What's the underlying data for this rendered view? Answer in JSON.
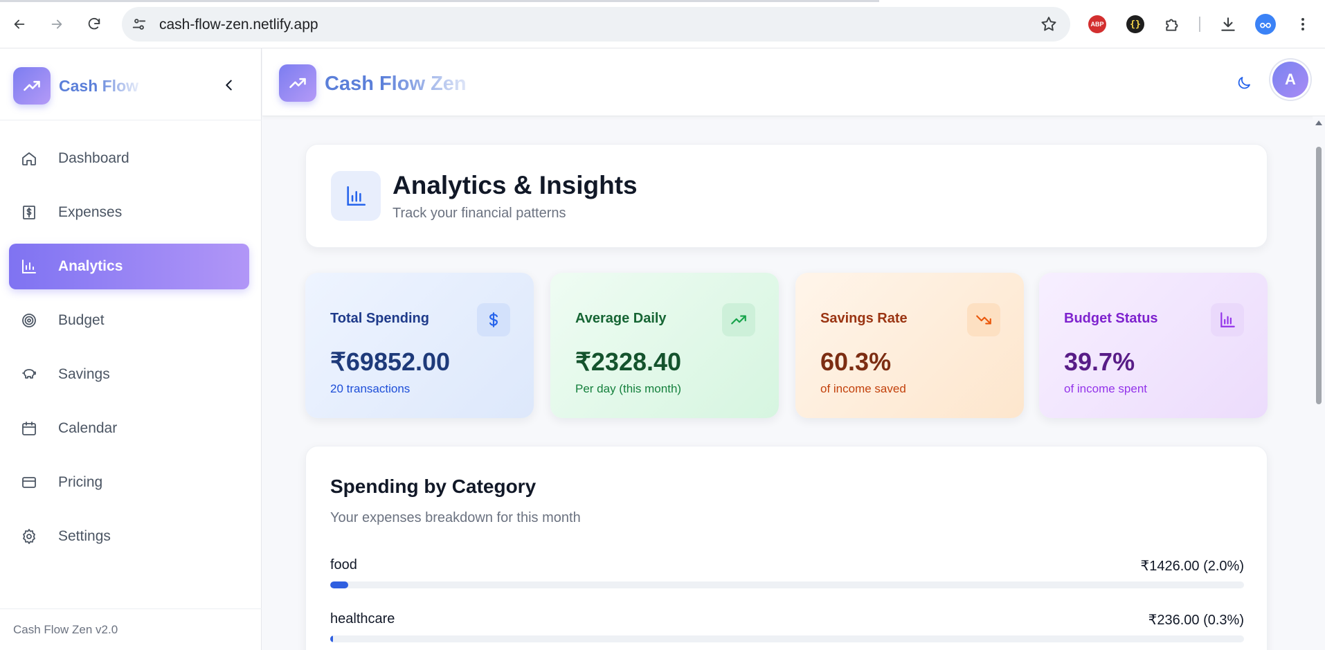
{
  "browser": {
    "url": "cash-flow-zen.netlify.app",
    "extensions": [
      "abp-extension-icon",
      "braces-extension-icon",
      "puzzle-extension-icon",
      "download-icon",
      "profile-icon",
      "menu-dots-icon"
    ],
    "abp_label": "ABP",
    "brace_label": "{}"
  },
  "sidebar": {
    "brand": "Cash Flow",
    "items": [
      {
        "label": "Dashboard",
        "icon": "home-icon"
      },
      {
        "label": "Expenses",
        "icon": "receipt-icon"
      },
      {
        "label": "Analytics",
        "icon": "bar-chart-icon",
        "active": true
      },
      {
        "label": "Budget",
        "icon": "target-icon"
      },
      {
        "label": "Savings",
        "icon": "piggy-bank-icon"
      },
      {
        "label": "Calendar",
        "icon": "calendar-icon"
      },
      {
        "label": "Pricing",
        "icon": "credit-card-icon"
      },
      {
        "label": "Settings",
        "icon": "gear-icon"
      }
    ],
    "footer": "Cash Flow Zen v2.0"
  },
  "header": {
    "brand": "Cash Flow Zen",
    "avatar_initial": "A"
  },
  "page": {
    "title": "Analytics & Insights",
    "subtitle": "Track your financial patterns"
  },
  "stats": [
    {
      "label": "Total Spending",
      "value": "₹69852.00",
      "sub": "20 transactions",
      "icon": "dollar-icon",
      "color": "#2563eb"
    },
    {
      "label": "Average Daily",
      "value": "₹2328.40",
      "sub": "Per day (this month)",
      "icon": "trending-up-icon",
      "color": "#16a34a"
    },
    {
      "label": "Savings Rate",
      "value": "60.3%",
      "sub": "of income saved",
      "icon": "trending-down-icon",
      "color": "#ea580c"
    },
    {
      "label": "Budget Status",
      "value": "39.7%",
      "sub": "of income spent",
      "icon": "bar-chart-icon",
      "color": "#9333ea"
    }
  ],
  "category": {
    "title": "Spending by Category",
    "subtitle": "Your expenses breakdown for this month",
    "rows": [
      {
        "name": "food",
        "amount": "₹1426.00 (2.0%)",
        "percent": 2.0
      },
      {
        "name": "healthcare",
        "amount": "₹236.00 (0.3%)",
        "percent": 0.3
      }
    ]
  },
  "colors": {
    "accent": "#7f73f2",
    "brand_text": "#5b7fd9",
    "bar_fill": "#2f5fe0"
  }
}
